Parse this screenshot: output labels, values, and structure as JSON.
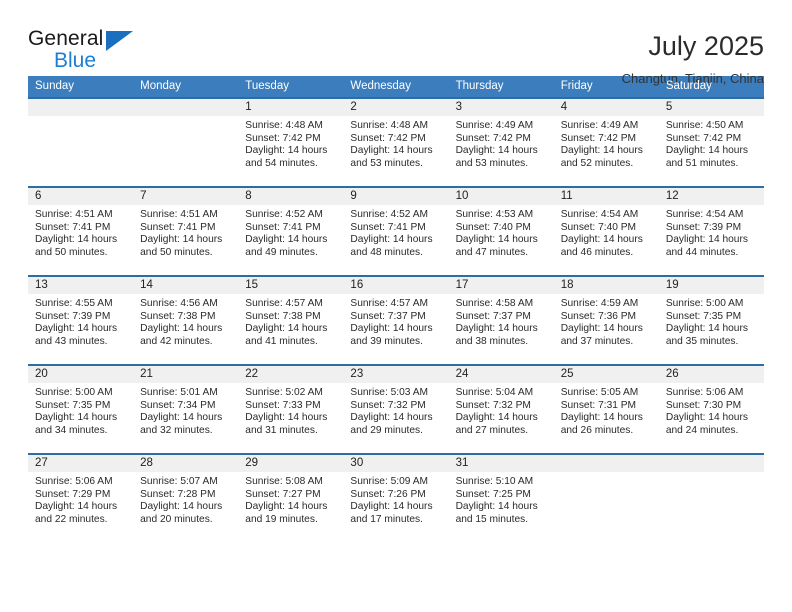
{
  "brand": {
    "name_top": "General",
    "name_bottom": "Blue",
    "accent": "#1b7fd4",
    "triangle": "#1b6fc0"
  },
  "header": {
    "month_year": "July 2025",
    "location": "Changtun, Tianjin, China",
    "header_bg": "#3b7dbd",
    "row_divider": "#2e6da4",
    "daynum_band": "#f0f0f0"
  },
  "weekday_headers": [
    "Sunday",
    "Monday",
    "Tuesday",
    "Wednesday",
    "Thursday",
    "Friday",
    "Saturday"
  ],
  "labels": {
    "sunrise": "Sunrise:",
    "sunset": "Sunset:",
    "daylight": "Daylight:"
  },
  "weeks": [
    [
      {
        "day": "",
        "sunrise": "",
        "sunset": "",
        "daylight": ""
      },
      {
        "day": "",
        "sunrise": "",
        "sunset": "",
        "daylight": ""
      },
      {
        "day": "1",
        "sunrise": "Sunrise: 4:48 AM",
        "sunset": "Sunset: 7:42 PM",
        "daylight": "Daylight: 14 hours and 54 minutes."
      },
      {
        "day": "2",
        "sunrise": "Sunrise: 4:48 AM",
        "sunset": "Sunset: 7:42 PM",
        "daylight": "Daylight: 14 hours and 53 minutes."
      },
      {
        "day": "3",
        "sunrise": "Sunrise: 4:49 AM",
        "sunset": "Sunset: 7:42 PM",
        "daylight": "Daylight: 14 hours and 53 minutes."
      },
      {
        "day": "4",
        "sunrise": "Sunrise: 4:49 AM",
        "sunset": "Sunset: 7:42 PM",
        "daylight": "Daylight: 14 hours and 52 minutes."
      },
      {
        "day": "5",
        "sunrise": "Sunrise: 4:50 AM",
        "sunset": "Sunset: 7:42 PM",
        "daylight": "Daylight: 14 hours and 51 minutes."
      }
    ],
    [
      {
        "day": "6",
        "sunrise": "Sunrise: 4:51 AM",
        "sunset": "Sunset: 7:41 PM",
        "daylight": "Daylight: 14 hours and 50 minutes."
      },
      {
        "day": "7",
        "sunrise": "Sunrise: 4:51 AM",
        "sunset": "Sunset: 7:41 PM",
        "daylight": "Daylight: 14 hours and 50 minutes."
      },
      {
        "day": "8",
        "sunrise": "Sunrise: 4:52 AM",
        "sunset": "Sunset: 7:41 PM",
        "daylight": "Daylight: 14 hours and 49 minutes."
      },
      {
        "day": "9",
        "sunrise": "Sunrise: 4:52 AM",
        "sunset": "Sunset: 7:41 PM",
        "daylight": "Daylight: 14 hours and 48 minutes."
      },
      {
        "day": "10",
        "sunrise": "Sunrise: 4:53 AM",
        "sunset": "Sunset: 7:40 PM",
        "daylight": "Daylight: 14 hours and 47 minutes."
      },
      {
        "day": "11",
        "sunrise": "Sunrise: 4:54 AM",
        "sunset": "Sunset: 7:40 PM",
        "daylight": "Daylight: 14 hours and 46 minutes."
      },
      {
        "day": "12",
        "sunrise": "Sunrise: 4:54 AM",
        "sunset": "Sunset: 7:39 PM",
        "daylight": "Daylight: 14 hours and 44 minutes."
      }
    ],
    [
      {
        "day": "13",
        "sunrise": "Sunrise: 4:55 AM",
        "sunset": "Sunset: 7:39 PM",
        "daylight": "Daylight: 14 hours and 43 minutes."
      },
      {
        "day": "14",
        "sunrise": "Sunrise: 4:56 AM",
        "sunset": "Sunset: 7:38 PM",
        "daylight": "Daylight: 14 hours and 42 minutes."
      },
      {
        "day": "15",
        "sunrise": "Sunrise: 4:57 AM",
        "sunset": "Sunset: 7:38 PM",
        "daylight": "Daylight: 14 hours and 41 minutes."
      },
      {
        "day": "16",
        "sunrise": "Sunrise: 4:57 AM",
        "sunset": "Sunset: 7:37 PM",
        "daylight": "Daylight: 14 hours and 39 minutes."
      },
      {
        "day": "17",
        "sunrise": "Sunrise: 4:58 AM",
        "sunset": "Sunset: 7:37 PM",
        "daylight": "Daylight: 14 hours and 38 minutes."
      },
      {
        "day": "18",
        "sunrise": "Sunrise: 4:59 AM",
        "sunset": "Sunset: 7:36 PM",
        "daylight": "Daylight: 14 hours and 37 minutes."
      },
      {
        "day": "19",
        "sunrise": "Sunrise: 5:00 AM",
        "sunset": "Sunset: 7:35 PM",
        "daylight": "Daylight: 14 hours and 35 minutes."
      }
    ],
    [
      {
        "day": "20",
        "sunrise": "Sunrise: 5:00 AM",
        "sunset": "Sunset: 7:35 PM",
        "daylight": "Daylight: 14 hours and 34 minutes."
      },
      {
        "day": "21",
        "sunrise": "Sunrise: 5:01 AM",
        "sunset": "Sunset: 7:34 PM",
        "daylight": "Daylight: 14 hours and 32 minutes."
      },
      {
        "day": "22",
        "sunrise": "Sunrise: 5:02 AM",
        "sunset": "Sunset: 7:33 PM",
        "daylight": "Daylight: 14 hours and 31 minutes."
      },
      {
        "day": "23",
        "sunrise": "Sunrise: 5:03 AM",
        "sunset": "Sunset: 7:32 PM",
        "daylight": "Daylight: 14 hours and 29 minutes."
      },
      {
        "day": "24",
        "sunrise": "Sunrise: 5:04 AM",
        "sunset": "Sunset: 7:32 PM",
        "daylight": "Daylight: 14 hours and 27 minutes."
      },
      {
        "day": "25",
        "sunrise": "Sunrise: 5:05 AM",
        "sunset": "Sunset: 7:31 PM",
        "daylight": "Daylight: 14 hours and 26 minutes."
      },
      {
        "day": "26",
        "sunrise": "Sunrise: 5:06 AM",
        "sunset": "Sunset: 7:30 PM",
        "daylight": "Daylight: 14 hours and 24 minutes."
      }
    ],
    [
      {
        "day": "27",
        "sunrise": "Sunrise: 5:06 AM",
        "sunset": "Sunset: 7:29 PM",
        "daylight": "Daylight: 14 hours and 22 minutes."
      },
      {
        "day": "28",
        "sunrise": "Sunrise: 5:07 AM",
        "sunset": "Sunset: 7:28 PM",
        "daylight": "Daylight: 14 hours and 20 minutes."
      },
      {
        "day": "29",
        "sunrise": "Sunrise: 5:08 AM",
        "sunset": "Sunset: 7:27 PM",
        "daylight": "Daylight: 14 hours and 19 minutes."
      },
      {
        "day": "30",
        "sunrise": "Sunrise: 5:09 AM",
        "sunset": "Sunset: 7:26 PM",
        "daylight": "Daylight: 14 hours and 17 minutes."
      },
      {
        "day": "31",
        "sunrise": "Sunrise: 5:10 AM",
        "sunset": "Sunset: 7:25 PM",
        "daylight": "Daylight: 14 hours and 15 minutes."
      },
      {
        "day": "",
        "sunrise": "",
        "sunset": "",
        "daylight": ""
      },
      {
        "day": "",
        "sunrise": "",
        "sunset": "",
        "daylight": ""
      }
    ]
  ]
}
